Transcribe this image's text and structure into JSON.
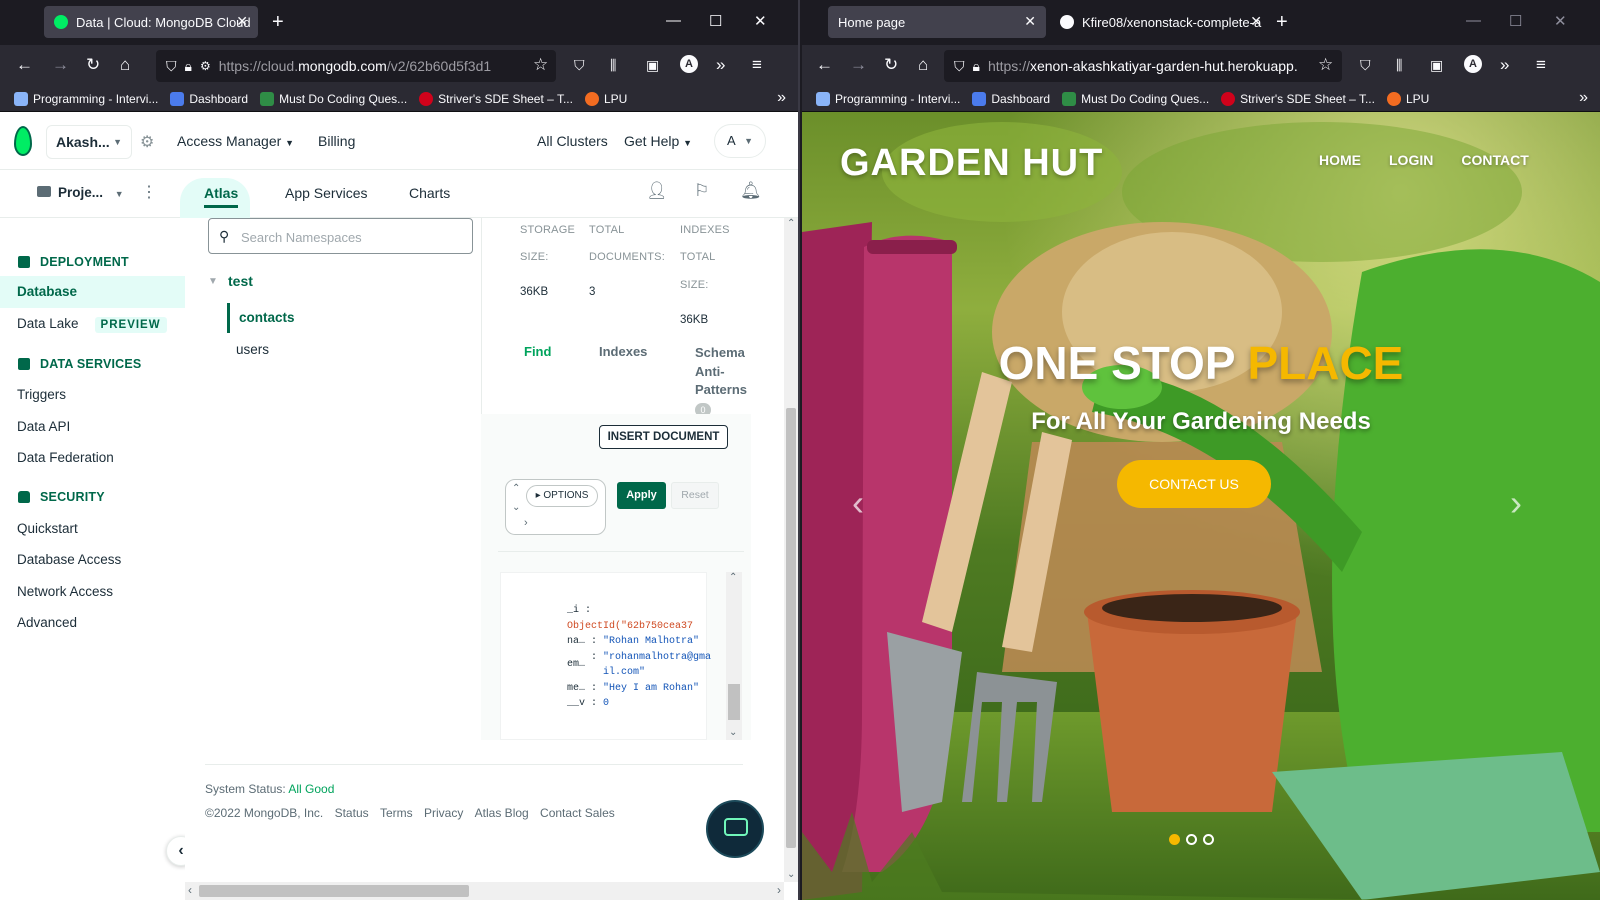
{
  "left_window": {
    "tabs": [
      {
        "title": "Data | Cloud: MongoDB Cloud",
        "active": true
      }
    ],
    "url": {
      "prefix": "https://cloud.",
      "domain": "mongodb.com",
      "path": "/v2/62b60d5f3d1"
    },
    "bookmarks": [
      "Programming - Intervi...",
      "Dashboard",
      "Must Do Coding Ques...",
      "Striver's SDE Sheet – T...",
      "LPU"
    ],
    "header": {
      "org": "Akash...",
      "access_manager": "Access Manager",
      "billing": "Billing",
      "all_clusters": "All Clusters",
      "get_help": "Get Help",
      "avatar": "A"
    },
    "subnav": {
      "project": "Proje...",
      "tabs": [
        "Atlas",
        "App Services",
        "Charts"
      ],
      "active_tab": "Atlas"
    },
    "sidebar": {
      "deployment_heading": "DEPLOYMENT",
      "database": "Database",
      "data_lake": "Data Lake",
      "preview_badge": "PREVIEW",
      "data_services_heading": "DATA SERVICES",
      "triggers": "Triggers",
      "data_api": "Data API",
      "data_federation": "Data Federation",
      "security_heading": "SECURITY",
      "quickstart": "Quickstart",
      "database_access": "Database Access",
      "network_access": "Network Access",
      "advanced": "Advanced"
    },
    "namespaces": {
      "search_placeholder": "Search Namespaces",
      "db": "test",
      "collections": [
        "contacts",
        "users"
      ],
      "selected": "contacts"
    },
    "stats": {
      "storage_label_1": "STORAGE",
      "storage_label_2": "SIZE:",
      "storage_value": "36KB",
      "docs_label_1": "TOTAL",
      "docs_label_2": "DOCUMENTS:",
      "docs_value": "3",
      "indexes_label_1": "INDEXES",
      "indexes_label_2": "TOTAL",
      "indexes_label_3": "SIZE:",
      "indexes_value": "36KB"
    },
    "collection_tabs": {
      "find": "Find",
      "indexes": "Indexes",
      "schema_1": "Schema",
      "schema_2": "Anti-",
      "schema_3": "Patterns",
      "schema_count": "0"
    },
    "insert_document": "INSERT DOCUMENT",
    "filter": {
      "options": "OPTIONS",
      "apply": "Apply",
      "reset": "Reset"
    },
    "document": [
      {
        "key": "_i",
        "value": "ObjectId(\"62b750cea37"
      },
      {
        "key": "na…",
        "value": "\"Rohan Malhotra\""
      },
      {
        "key": "em…",
        "value": "\"rohanmalhotra@gma",
        "value2": "il.com\""
      },
      {
        "key": "me…",
        "value": "\"Hey I am Rohan\""
      },
      {
        "key": "__v",
        "value": "0"
      }
    ],
    "footer": {
      "status_label": "System Status:",
      "status_value": "All Good",
      "copyright": "©2022 MongoDB, Inc.",
      "links": [
        "Status",
        "Terms",
        "Privacy",
        "Atlas Blog",
        "Contact Sales"
      ]
    }
  },
  "right_window": {
    "tabs": [
      {
        "title": "Home page",
        "active": true
      },
      {
        "title": "Kfire08/xenonstack-complete-a",
        "active": false
      }
    ],
    "url": {
      "prefix": "https://",
      "domain": "xenon-akashkatiyar-garden-hut.herokuapp.",
      "path": ""
    },
    "bookmarks": [
      "Programming - Intervi...",
      "Dashboard",
      "Must Do Coding Ques...",
      "Striver's SDE Sheet – T...",
      "LPU"
    ],
    "site": {
      "logo": "GARDEN HUT",
      "nav": [
        "HOME",
        "LOGIN",
        "CONTACT"
      ],
      "headline_white": "ONE STOP",
      "headline_yellow": "PLACE",
      "subheadline": "For All Your Gardening Needs",
      "cta": "CONTACT US",
      "slide_active": 1,
      "slide_count": 3
    }
  },
  "colors": {
    "mongo_green": "#00684a",
    "mongo_light": "#e3fcf7",
    "garden_yellow": "#f5b800",
    "firefox_dark": "#1c1b22",
    "firefox_bar": "#2b2a33"
  }
}
